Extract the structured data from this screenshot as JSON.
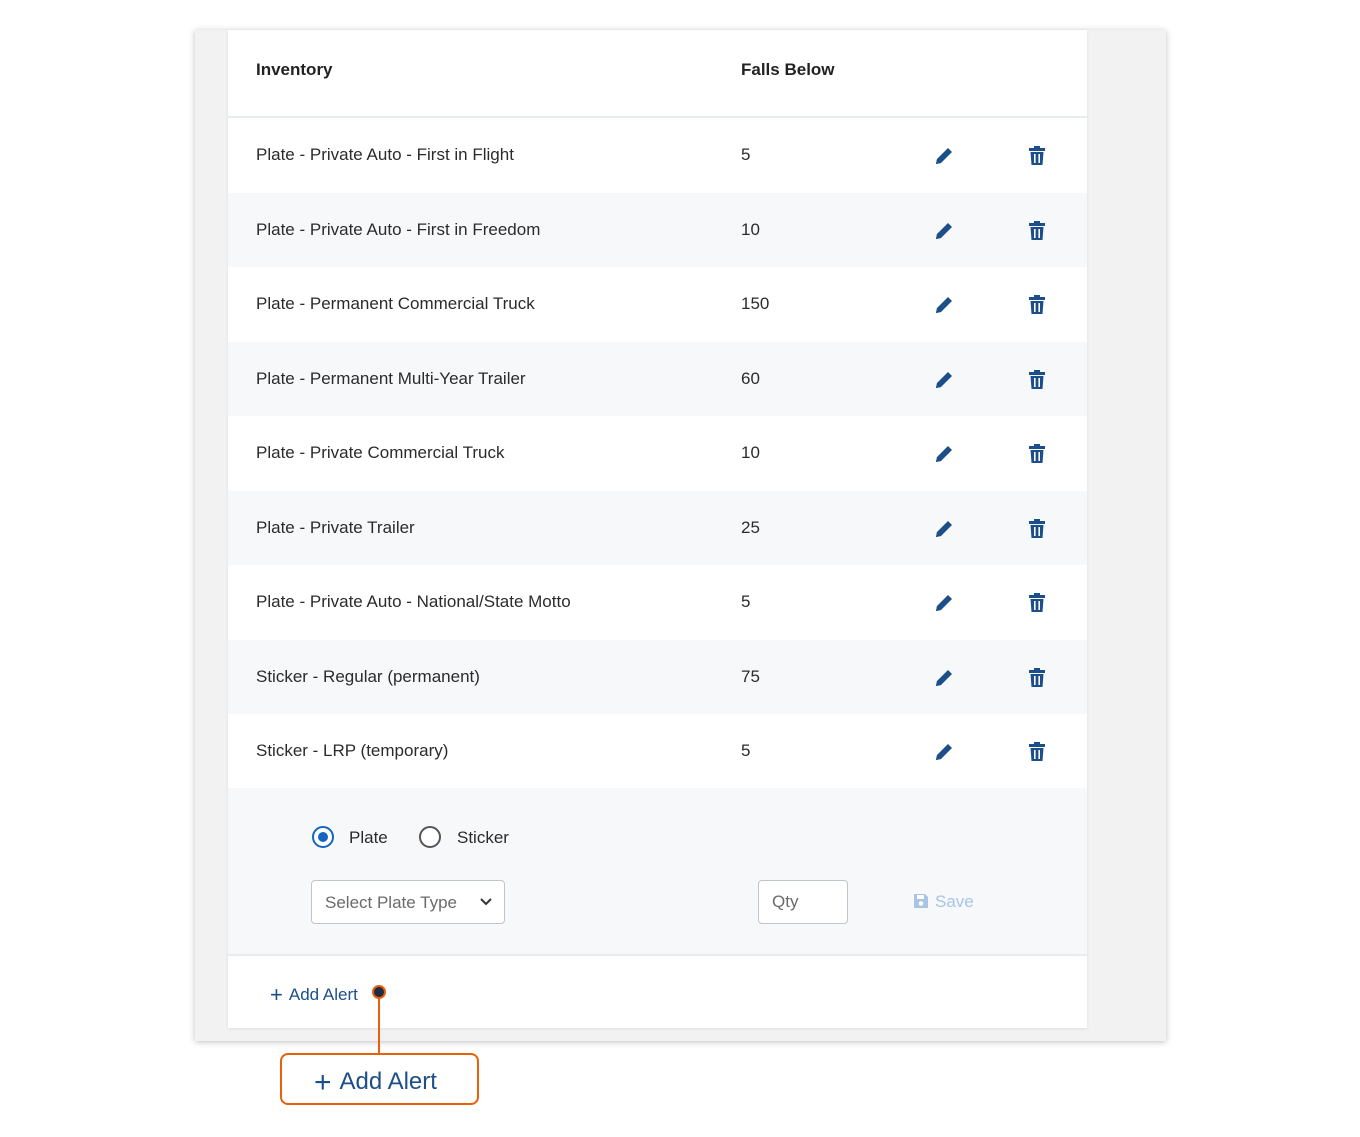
{
  "table": {
    "headers": {
      "inventory": "Inventory",
      "falls_below": "Falls Below"
    },
    "rows": [
      {
        "name": "Plate - Private Auto - First in Flight",
        "qty": "5"
      },
      {
        "name": "Plate - Private Auto - First in Freedom",
        "qty": "10"
      },
      {
        "name": "Plate - Permanent Commercial Truck",
        "qty": "150"
      },
      {
        "name": "Plate - Permanent Multi-Year Trailer",
        "qty": "60"
      },
      {
        "name": "Plate - Private Commercial Truck",
        "qty": "10"
      },
      {
        "name": "Plate - Private Trailer",
        "qty": "25"
      },
      {
        "name": "Plate - Private Auto - National/State Motto",
        "qty": "5"
      },
      {
        "name": "Sticker - Regular (permanent)",
        "qty": "75"
      },
      {
        "name": "Sticker - LRP (temporary)",
        "qty": "5"
      }
    ]
  },
  "form": {
    "radio_plate": "Plate",
    "radio_sticker": "Sticker",
    "selected": "Plate",
    "select_placeholder": "Select Plate Type",
    "qty_placeholder": "Qty",
    "save_label": "Save"
  },
  "add_alert_label": "Add Alert",
  "callout_label": "Add Alert",
  "icons": {
    "edit": "pencil-icon",
    "delete": "trash-icon",
    "save": "floppy-disk-icon",
    "add": "plus-icon",
    "dropdown": "chevron-down-icon"
  },
  "colors": {
    "primary": "#1565c0",
    "link": "#1c4f8a",
    "callout": "#e8600a",
    "disabled": "#a9c4e4"
  }
}
